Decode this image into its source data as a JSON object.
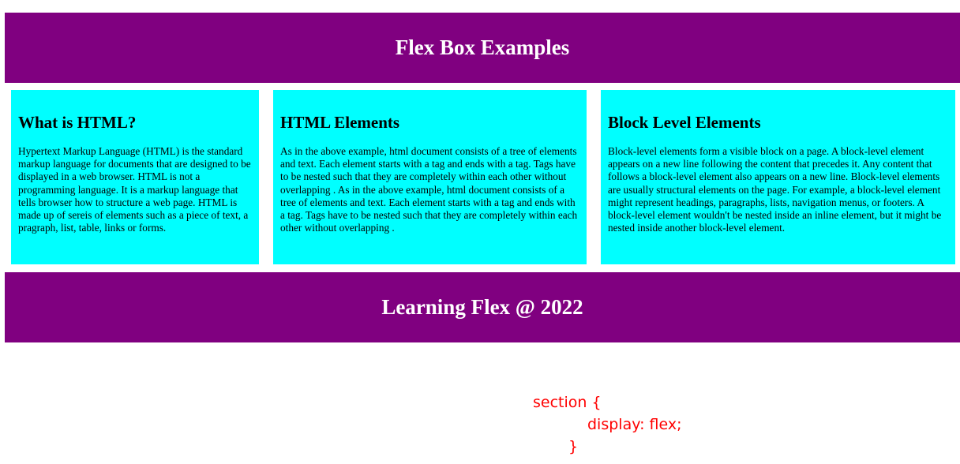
{
  "header": {
    "title": "Flex Box Examples"
  },
  "cards": [
    {
      "title": "What is HTML?",
      "text": "Hypertext Markup Language (HTML) is the standard markup language for documents that are designed to be displayed in a web browser. HTML is not a programming language. It is a markup language that tells browser how to structure a web page. HTML is made up of sereis of elements such as a piece of text, a pragraph, list, table, links or forms."
    },
    {
      "title": "HTML Elements",
      "text": "As in the above example, html document consists of a tree of elements and text. Each element starts with a tag and ends with a tag. Tags have to be nested such that they are completely within each other without overlapping . As in the above example, html document consists of a tree of elements and text. Each element starts with a tag and ends with a tag. Tags have to be nested such that they are completely within each other without overlapping ."
    },
    {
      "title": "Block Level Elements",
      "text": "Block-level elements form a visible block on a page. A block-level element appears on a new line following the content that precedes it. Any content that follows a block-level element also appears on a new line. Block-level elements are usually structural elements on the page. For example, a block-level element might represent headings, paragraphs, lists, navigation menus, or footers. A block-level element wouldn't be nested inside an inline element, but it might be nested inside another block-level element."
    }
  ],
  "footer": {
    "title": "Learning Flex @ 2022"
  },
  "code": {
    "line1": "section {",
    "line2": "display: flex;",
    "line3": "}"
  },
  "colors": {
    "purple": "#800080",
    "cyan": "#00ffff",
    "code": "#ff0000"
  }
}
